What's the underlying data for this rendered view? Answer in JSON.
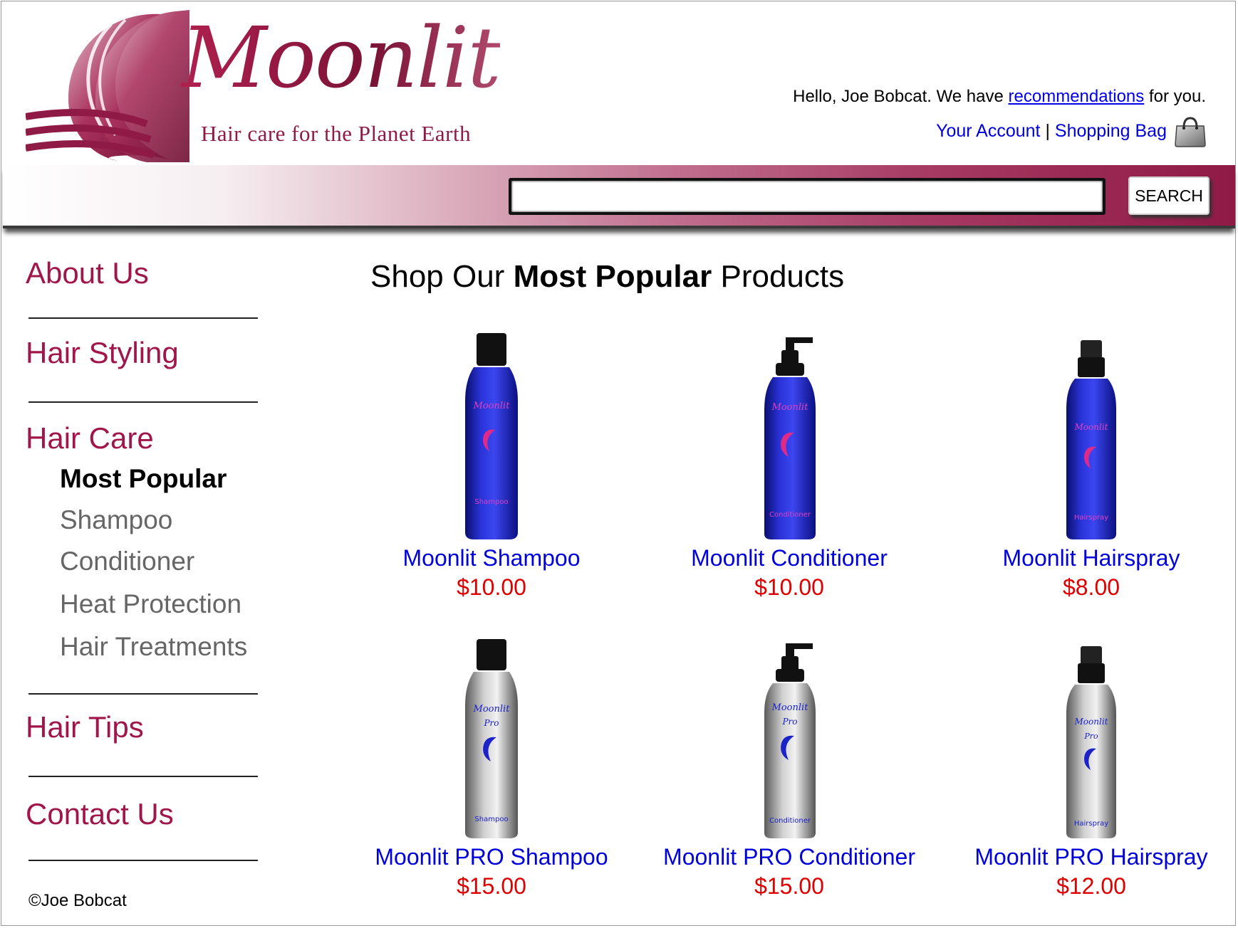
{
  "brand": {
    "name": "Moonlit",
    "tagline": "Hair care for the Planet Earth"
  },
  "header": {
    "greeting_prefix": "Hello, Joe Bobcat. We have ",
    "greeting_link": "recommendations",
    "greeting_suffix": " for you.",
    "account_link": "Your Account",
    "separator": "|",
    "bag_link": "Shopping Bag"
  },
  "search": {
    "value": "",
    "button_label": "SEARCH"
  },
  "sidebar": {
    "items": [
      {
        "label": "About Us"
      },
      {
        "label": "Hair Styling"
      },
      {
        "label": "Hair Care"
      },
      {
        "label": "Hair Tips"
      },
      {
        "label": "Contact Us"
      }
    ],
    "subitems": [
      {
        "label": "Most Popular",
        "active": true
      },
      {
        "label": "Shampoo"
      },
      {
        "label": "Conditioner"
      },
      {
        "label": "Heat Protection"
      },
      {
        "label": "Hair Treatments"
      }
    ]
  },
  "footer": {
    "copyright": "©Joe Bobcat"
  },
  "main": {
    "title_prefix": "Shop Our ",
    "title_bold": "Most Popular",
    "title_suffix": " Products",
    "products": [
      {
        "name": "Moonlit Shampoo",
        "price": "$10.00",
        "bottle_label": "Shampoo",
        "logo_text": "Moonlit",
        "pro_text": ""
      },
      {
        "name": "Moonlit Conditioner",
        "price": "$10.00",
        "bottle_label": "Conditioner",
        "logo_text": "Moonlit",
        "pro_text": ""
      },
      {
        "name": "Moonlit Hairspray",
        "price": "$8.00",
        "bottle_label": "Hairspray",
        "logo_text": "Moonlit",
        "pro_text": ""
      },
      {
        "name": "Moonlit PRO Shampoo",
        "price": "$15.00",
        "bottle_label": "Shampoo",
        "logo_text": "Moonlit",
        "pro_text": "Pro"
      },
      {
        "name": "Moonlit PRO Conditioner",
        "price": "$15.00",
        "bottle_label": "Conditioner",
        "logo_text": "Moonlit",
        "pro_text": "Pro"
      },
      {
        "name": "Moonlit PRO Hairspray",
        "price": "$12.00",
        "bottle_label": "Hairspray",
        "logo_text": "Moonlit",
        "pro_text": "Pro"
      }
    ]
  },
  "colors": {
    "brand": "#8f1a45",
    "nav": "#a0164a",
    "link": "#0000dd",
    "price": "#e00000",
    "bottle_blue": "#1a22c8",
    "bottle_silver": "#9a9a9a"
  },
  "icons": {
    "logo": "crescent-moon-logo-icon",
    "bag": "shopping-bag-icon"
  }
}
